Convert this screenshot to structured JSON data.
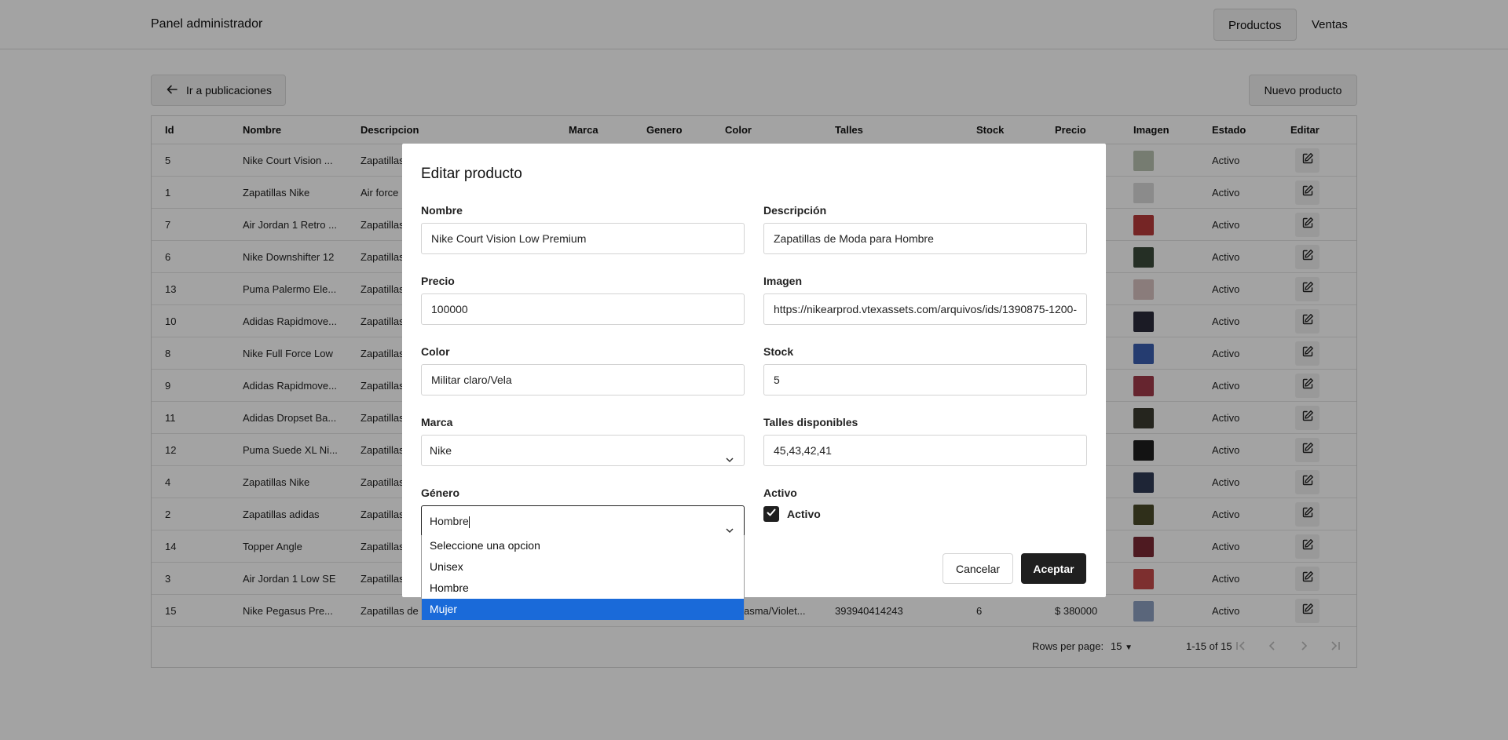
{
  "header": {
    "brand": "Panel administrador",
    "nav": [
      "Productos",
      "Ventas"
    ]
  },
  "toolbar": {
    "back_label": "Ir a publicaciones",
    "new_label": "Nuevo producto"
  },
  "table": {
    "columns": [
      "Id",
      "Nombre",
      "Descripcion",
      "Marca",
      "Genero",
      "Color",
      "Talles",
      "Stock",
      "Precio",
      "Imagen",
      "Estado",
      "Editar"
    ],
    "rows": [
      {
        "id": "5",
        "nombre": "Nike Court Vision ...",
        "desc": "Zapatillas",
        "estado": "Activo",
        "thumb": "#b9c3b1"
      },
      {
        "id": "1",
        "nombre": "Zapatillas Nike",
        "desc": "Air force",
        "estado": "Activo",
        "thumb": "#d9d9d9"
      },
      {
        "id": "7",
        "nombre": "Air Jordan 1 Retro ...",
        "desc": "Zapatillas",
        "estado": "Activo",
        "thumb": "#b73a3a"
      },
      {
        "id": "6",
        "nombre": "Nike Downshifter 12",
        "desc": "Zapatillas",
        "estado": "Activo",
        "thumb": "#3a4a3a"
      },
      {
        "id": "13",
        "nombre": "Puma Palermo Ele...",
        "desc": "Zapatillas",
        "estado": "Activo",
        "thumb": "#d8c2c0"
      },
      {
        "id": "10",
        "nombre": "Adidas Rapidmove...",
        "desc": "Zapatillas",
        "estado": "Activo",
        "thumb": "#2b2b3a"
      },
      {
        "id": "8",
        "nombre": "Nike Full Force Low",
        "desc": "Zapatillas",
        "estado": "Activo",
        "thumb": "#3a5fb0"
      },
      {
        "id": "9",
        "nombre": "Adidas Rapidmove...",
        "desc": "Zapatillas",
        "estado": "Activo",
        "thumb": "#a03a4a"
      },
      {
        "id": "11",
        "nombre": "Adidas Dropset Ba...",
        "desc": "Zapatillas",
        "estado": "Activo",
        "thumb": "#3a3a30"
      },
      {
        "id": "12",
        "nombre": "Puma Suede XL Ni...",
        "desc": "Zapatillas",
        "estado": "Activo",
        "thumb": "#1f1f1f"
      },
      {
        "id": "4",
        "nombre": "Zapatillas Nike",
        "desc": "Zapatillas",
        "estado": "Activo",
        "thumb": "#2f3a55"
      },
      {
        "id": "2",
        "nombre": "Zapatillas adidas",
        "desc": "Zapatillas",
        "estado": "Activo",
        "thumb": "#4a4a2a"
      },
      {
        "id": "14",
        "nombre": "Topper Angle",
        "desc": "Zapatillas",
        "estado": "Activo",
        "thumb": "#7a2a35"
      },
      {
        "id": "3",
        "nombre": "Air Jordan 1 Low SE",
        "desc": "Zapatillas",
        "estado": "Activo",
        "thumb": "#c44a4a"
      },
      {
        "id": "15",
        "nombre": "Nike Pegasus Pre...",
        "desc": "Zapatillas de",
        "color": "asma/Violet...",
        "talles": "393940414243",
        "stock": "6",
        "precio": "$ 380000",
        "estado": "Activo",
        "thumb": "#8da0c0"
      }
    ]
  },
  "pagination": {
    "rows_label": "Rows per page:",
    "rows_value": "15",
    "range": "1-15 of 15"
  },
  "modal": {
    "title": "Editar producto",
    "fields": {
      "nombre_label": "Nombre",
      "nombre_value": "Nike Court Vision Low Premium",
      "descripcion_label": "Descripción",
      "descripcion_value": "Zapatillas de Moda para Hombre",
      "precio_label": "Precio",
      "precio_value": "100000",
      "imagen_label": "Imagen",
      "imagen_value": "https://nikearprod.vtexassets.com/arquivos/ids/1390875-1200-",
      "color_label": "Color",
      "color_value": "Militar claro/Vela",
      "stock_label": "Stock",
      "stock_value": "5",
      "marca_label": "Marca",
      "marca_value": "Nike",
      "talles_label": "Talles disponibles",
      "talles_value": "45,43,42,41",
      "genero_label": "Género",
      "genero_value": "Hombre",
      "activo_label": "Activo",
      "activo_check_label": "Activo"
    },
    "cancel_label": "Cancelar",
    "accept_label": "Aceptar"
  },
  "genero_dropdown": {
    "options": [
      "Seleccione una opcion",
      "Unisex",
      "Hombre",
      "Mujer"
    ],
    "highlighted": "Mujer"
  },
  "colors": {
    "accent_dark": "#1f1f1f",
    "dropdown_highlight": "#1a6ad9"
  }
}
